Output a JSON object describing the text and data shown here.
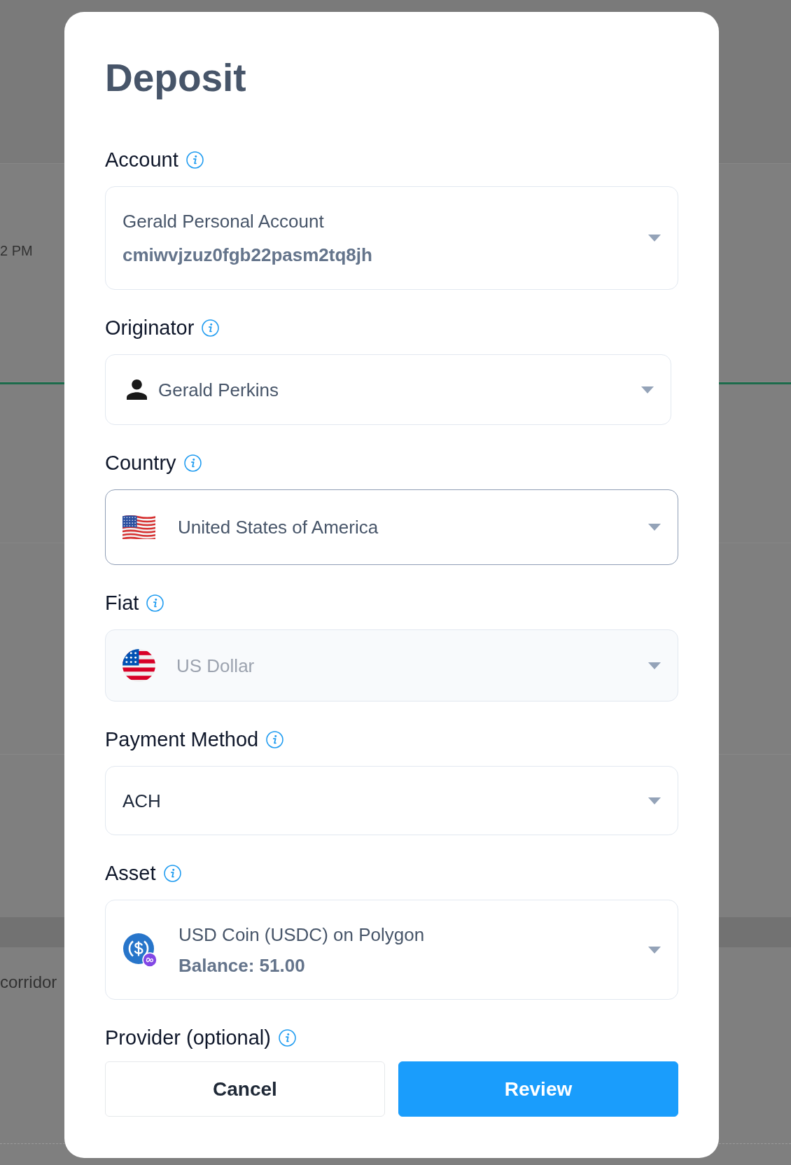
{
  "background": {
    "time_fragment": "2 PM",
    "row_fragment": "corridor"
  },
  "dialog": {
    "title": "Deposit",
    "fields": [
      {
        "kind": "account",
        "label": "Account",
        "value": "Gerald Personal Account",
        "detail": "cmiwvjzuz0fgb22pasm2tq8jh",
        "focused": false,
        "disabled": false
      },
      {
        "kind": "person",
        "label": "Originator",
        "value": "Gerald Perkins",
        "focused": false,
        "disabled": false
      },
      {
        "kind": "flag",
        "label": "Country",
        "value": "United States of America",
        "focused": true,
        "disabled": false
      },
      {
        "kind": "round_flag",
        "label": "Fiat",
        "value": "US Dollar",
        "focused": false,
        "disabled": true
      },
      {
        "kind": "plain",
        "label": "Payment Method",
        "value": "ACH",
        "focused": false,
        "disabled": false
      },
      {
        "kind": "coin",
        "label": "Asset",
        "value": "USD Coin (USDC) on Polygon",
        "detail": "Balance: 51.00",
        "focused": false,
        "disabled": false
      },
      {
        "kind": "label_only",
        "label": "Provider (optional)"
      }
    ],
    "buttons": [
      {
        "kind": "secondary",
        "label": "Cancel"
      },
      {
        "kind": "primary",
        "label": "Review"
      }
    ]
  }
}
